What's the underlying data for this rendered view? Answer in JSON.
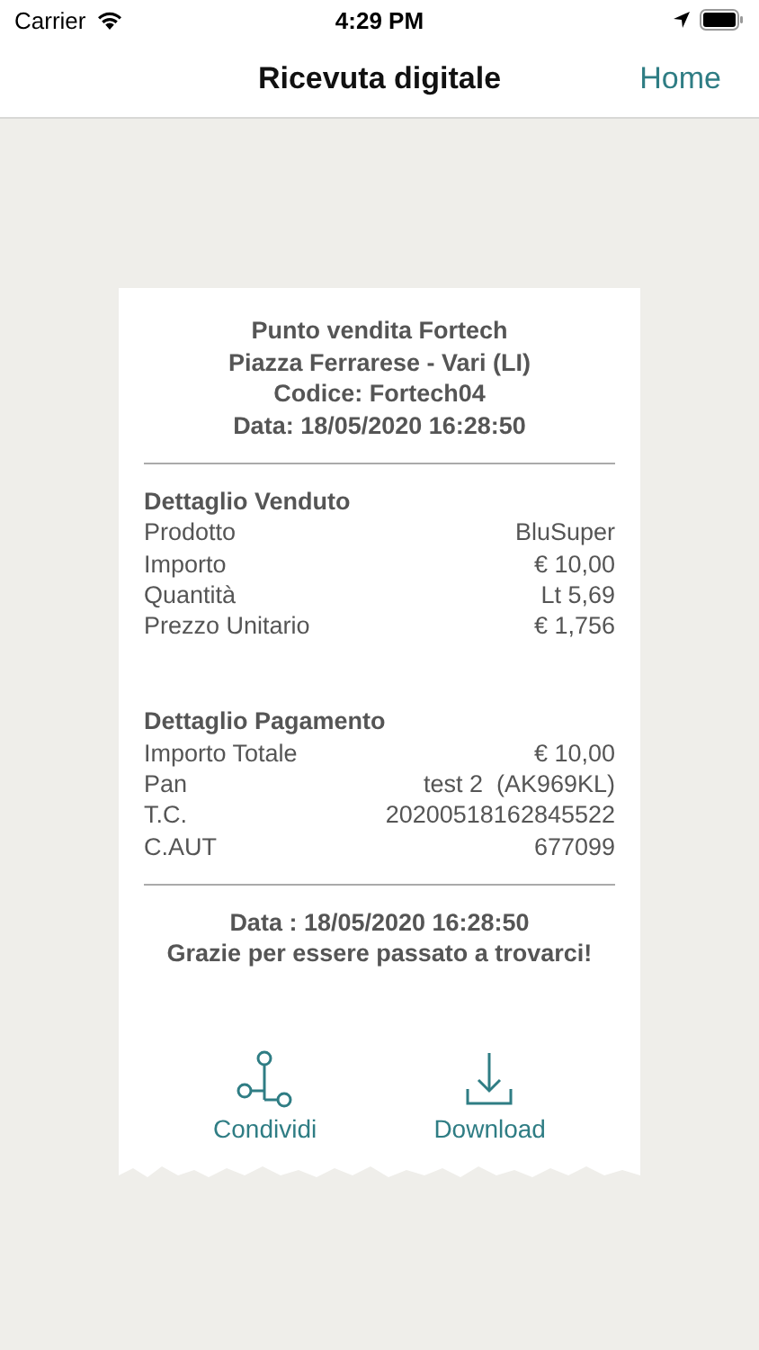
{
  "status_bar": {
    "carrier": "Carrier",
    "time": "4:29 PM"
  },
  "nav": {
    "title": "Ricevuta digitale",
    "action": "Home"
  },
  "receipt": {
    "header": [
      "Punto vendita Fortech",
      "Piazza Ferrarese - Vari (LI)",
      "Codice: Fortech04",
      "Data: 18/05/2020 16:28:50"
    ],
    "sections": [
      {
        "title": "Dettaglio Venduto",
        "rows": [
          {
            "label": "Prodotto",
            "value": "BluSuper"
          },
          {
            "label": "Importo",
            "value": "€ 10,00"
          },
          {
            "label": "Quantità",
            "value": "Lt 5,69"
          },
          {
            "label": "Prezzo Unitario",
            "value": "€ 1,756"
          }
        ]
      },
      {
        "title": "Dettaglio Pagamento",
        "rows": [
          {
            "label": "Importo Totale",
            "value": "€ 10,00"
          },
          {
            "label": "Pan",
            "value": "test 2  (AK969KL)"
          },
          {
            "label": "T.C.",
            "value": "20200518162845522"
          },
          {
            "label": "C.AUT",
            "value": "677099"
          }
        ]
      }
    ],
    "footer": [
      "Data : 18/05/2020 16:28:50",
      "Grazie per essere passato a trovarci!"
    ],
    "actions": [
      {
        "kind": "share",
        "label": "Condividi"
      },
      {
        "kind": "download",
        "label": "Download"
      }
    ]
  }
}
